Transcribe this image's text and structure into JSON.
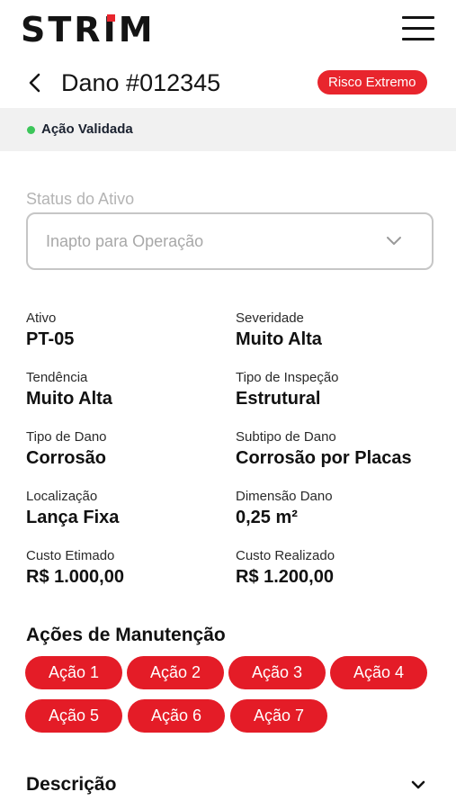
{
  "app": {
    "brand": "STRIM",
    "menu_icon": "hamburger-icon"
  },
  "header": {
    "back_icon": "chevron-left-icon",
    "title": "Dano #012345",
    "risk_badge": "Risco Extremo"
  },
  "status": {
    "text": "Ação Validada",
    "dot_color": "#3cc65a"
  },
  "asset_status": {
    "label": "Status do Ativo",
    "value": "Inapto para Operação"
  },
  "details": [
    {
      "label": "Ativo",
      "value": "PT-05"
    },
    {
      "label": "Severidade",
      "value": "Muito Alta"
    },
    {
      "label": "Tendência",
      "value": "Muito Alta"
    },
    {
      "label": "Tipo de Inspeção",
      "value": "Estrutural"
    },
    {
      "label": "Tipo de Dano",
      "value": "Corrosão"
    },
    {
      "label": "Subtipo de Dano",
      "value": "Corrosão por Placas"
    },
    {
      "label": "Localização",
      "value": "Lança Fixa"
    },
    {
      "label": "Dimensão Dano",
      "value": "0,25 m²"
    },
    {
      "label": "Custo Etimado",
      "value": "R$ 1.000,00"
    },
    {
      "label": "Custo Realizado",
      "value": "R$ 1.200,00"
    }
  ],
  "maintenance": {
    "title": "Ações de Manutenção",
    "actions": [
      "Ação 1",
      "Ação 2",
      "Ação 3",
      "Ação 4",
      "Ação 5",
      "Ação 6",
      "Ação 7"
    ]
  },
  "description": {
    "title": "Descrição"
  },
  "colors": {
    "accent": "#e41c27",
    "text": "#141414",
    "strip_bg": "#f1f1f1"
  }
}
